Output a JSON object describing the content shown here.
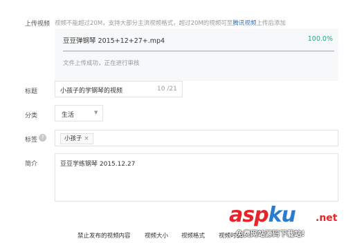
{
  "upload": {
    "label": "上传视频",
    "hint_prefix": "视频不能超过20M，支持大部分主流视频格式，超过20M的视频可至",
    "hint_link": "腾讯视频",
    "hint_suffix": "上传后添加",
    "file_name": "豆豆弹钢琴 2015+12+27+.mp4",
    "progress_text": "100.0%",
    "progress": 1.0,
    "status": "文件上传成功，正在进行审核"
  },
  "title": {
    "label": "标题",
    "value": "小孩子的学钢琴的视频",
    "counter": "10 /21"
  },
  "category": {
    "label": "分类",
    "value": "生活"
  },
  "tags": {
    "label": "标签",
    "help_glyph": "?",
    "items": [
      {
        "text": "小孩子",
        "remove": "×"
      }
    ]
  },
  "intro": {
    "label": "简介",
    "value": "豆豆学练钢琴 2015.12.27"
  },
  "footer": {
    "links": [
      "禁止发布的视频内容",
      "视频大小",
      "视频格式",
      "视频时长"
    ]
  },
  "watermark": {
    "logo_a": "asp",
    "logo_b": "ku",
    "net": ".net",
    "sub": "免费网站源码下载站!"
  },
  "colors": {
    "accent_link": "#2f74c0",
    "percent_green": "#1ea87b",
    "watermark_red": "#e8242a"
  }
}
